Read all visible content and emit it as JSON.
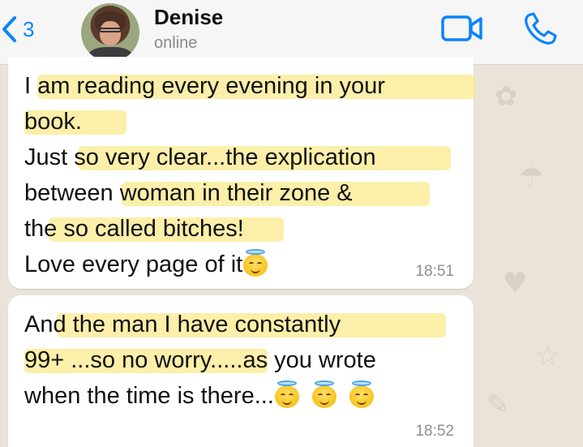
{
  "header": {
    "back_count": "3",
    "contact_name": "Denise",
    "status": "online",
    "icons": {
      "back": "chevron-left-icon",
      "video": "video-camera-icon",
      "call": "phone-icon"
    },
    "accent_color": "#0a84ff"
  },
  "messages": [
    {
      "lines": [
        "I am reading every evening in your",
        "book.",
        "Just so very clear...the explication",
        "between woman in their zone &",
        "the so called bitches!",
        "Love every page of it"
      ],
      "emoji": "smiling-face-with-halo",
      "time": "18:51"
    },
    {
      "lines": [
        "And the man I have constantly",
        "99+ ...so no worry.....as you wrote",
        "when the time is there..."
      ],
      "emoji": "smiling-face-with-halo",
      "time": "18:52"
    }
  ],
  "highlight_color": "#fbe98c"
}
